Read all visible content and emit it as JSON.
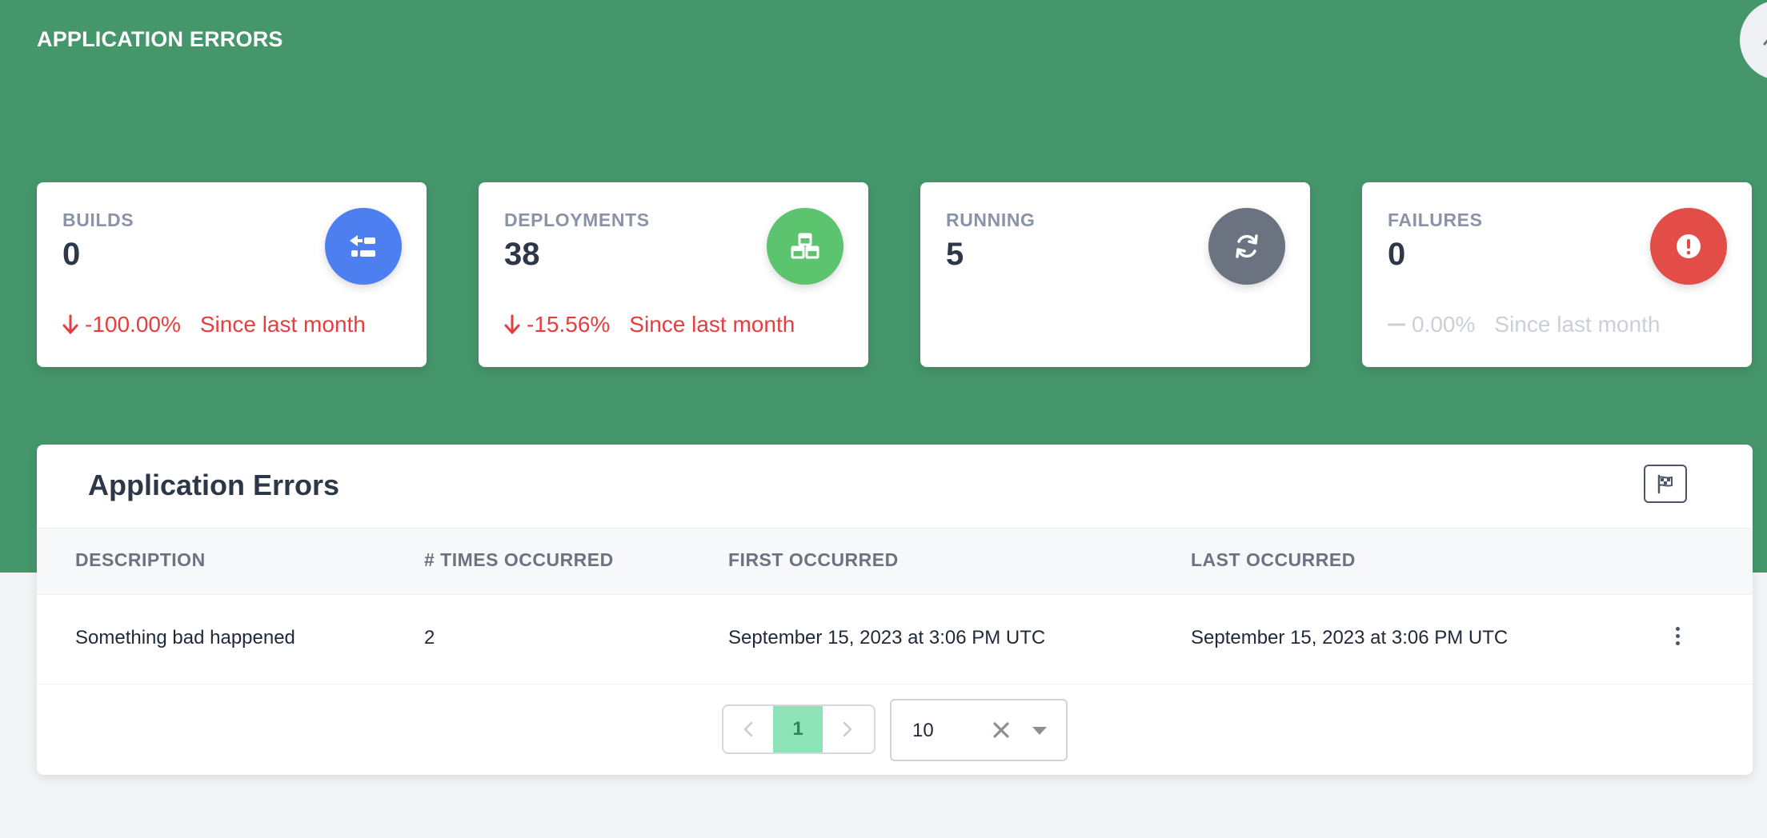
{
  "header": {
    "title": "APPLICATION ERRORS"
  },
  "stats": [
    {
      "label": "BUILDS",
      "value": "0",
      "icon": "builds-icon",
      "color": "#4e7ff0",
      "trend_pct": "-100.00%",
      "trend_text": "Since last month",
      "trend_dir": "down"
    },
    {
      "label": "DEPLOYMENTS",
      "value": "38",
      "icon": "cubes-icon",
      "color": "#5cc46e",
      "trend_pct": "-15.56%",
      "trend_text": "Since last month",
      "trend_dir": "down"
    },
    {
      "label": "RUNNING",
      "value": "5",
      "icon": "sync-icon",
      "color": "#6b7280"
    },
    {
      "label": "FAILURES",
      "value": "0",
      "icon": "exclamation-circle-icon",
      "color": "#e34d47",
      "trend_pct": "0.00%",
      "trend_text": "Since last month",
      "trend_dir": "flat"
    }
  ],
  "panel": {
    "title": "Application Errors",
    "flag_icon": "flag-checkered-icon",
    "columns": [
      "DESCRIPTION",
      "# TIMES OCCURRED",
      "FIRST OCCURRED",
      "LAST OCCURRED"
    ],
    "rows": [
      {
        "description": "Something bad happened",
        "count": "2",
        "first": "September 15, 2023 at 3:06 PM UTC",
        "last": "September 15, 2023 at 3:06 PM UTC"
      }
    ]
  },
  "pagination": {
    "current_page": "1",
    "per_page": "10"
  },
  "colors": {
    "brand": "#45966b",
    "danger": "#e53e3e",
    "active_page": "#8fe3b9"
  }
}
